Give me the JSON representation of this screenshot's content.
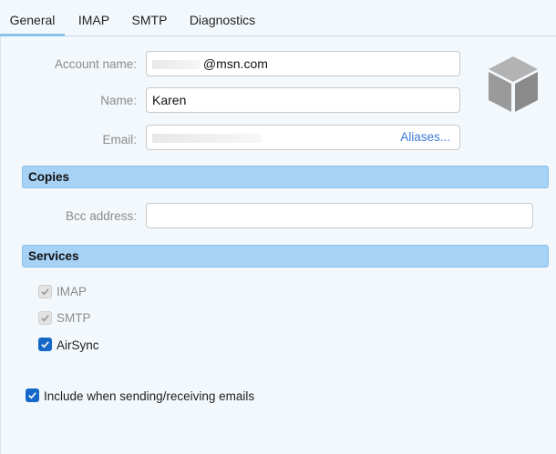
{
  "tabs": [
    {
      "label": "General",
      "active": true
    },
    {
      "label": "IMAP",
      "active": false
    },
    {
      "label": "SMTP",
      "active": false
    },
    {
      "label": "Diagnostics",
      "active": false
    }
  ],
  "account": {
    "account_name_label": "Account name:",
    "account_name_value": "@msn.com",
    "name_label": "Name:",
    "name_value": "Karen",
    "email_label": "Email:",
    "email_value": "",
    "aliases_link": "Aliases..."
  },
  "copies": {
    "header": "Copies",
    "bcc_label": "Bcc address:",
    "bcc_value": ""
  },
  "services": {
    "header": "Services",
    "items": [
      {
        "label": "IMAP",
        "checked": true,
        "enabled": false
      },
      {
        "label": "SMTP",
        "checked": true,
        "enabled": false
      },
      {
        "label": "AirSync",
        "checked": true,
        "enabled": true
      }
    ]
  },
  "include": {
    "label": "Include when sending/receiving emails",
    "checked": true
  },
  "icons": {
    "account_type": "cube-icon",
    "check": "checkmark-icon"
  },
  "colors": {
    "accent": "#1668c8",
    "section_bg": "#a6d2f6",
    "tab_underline": "#8cc3ea"
  }
}
